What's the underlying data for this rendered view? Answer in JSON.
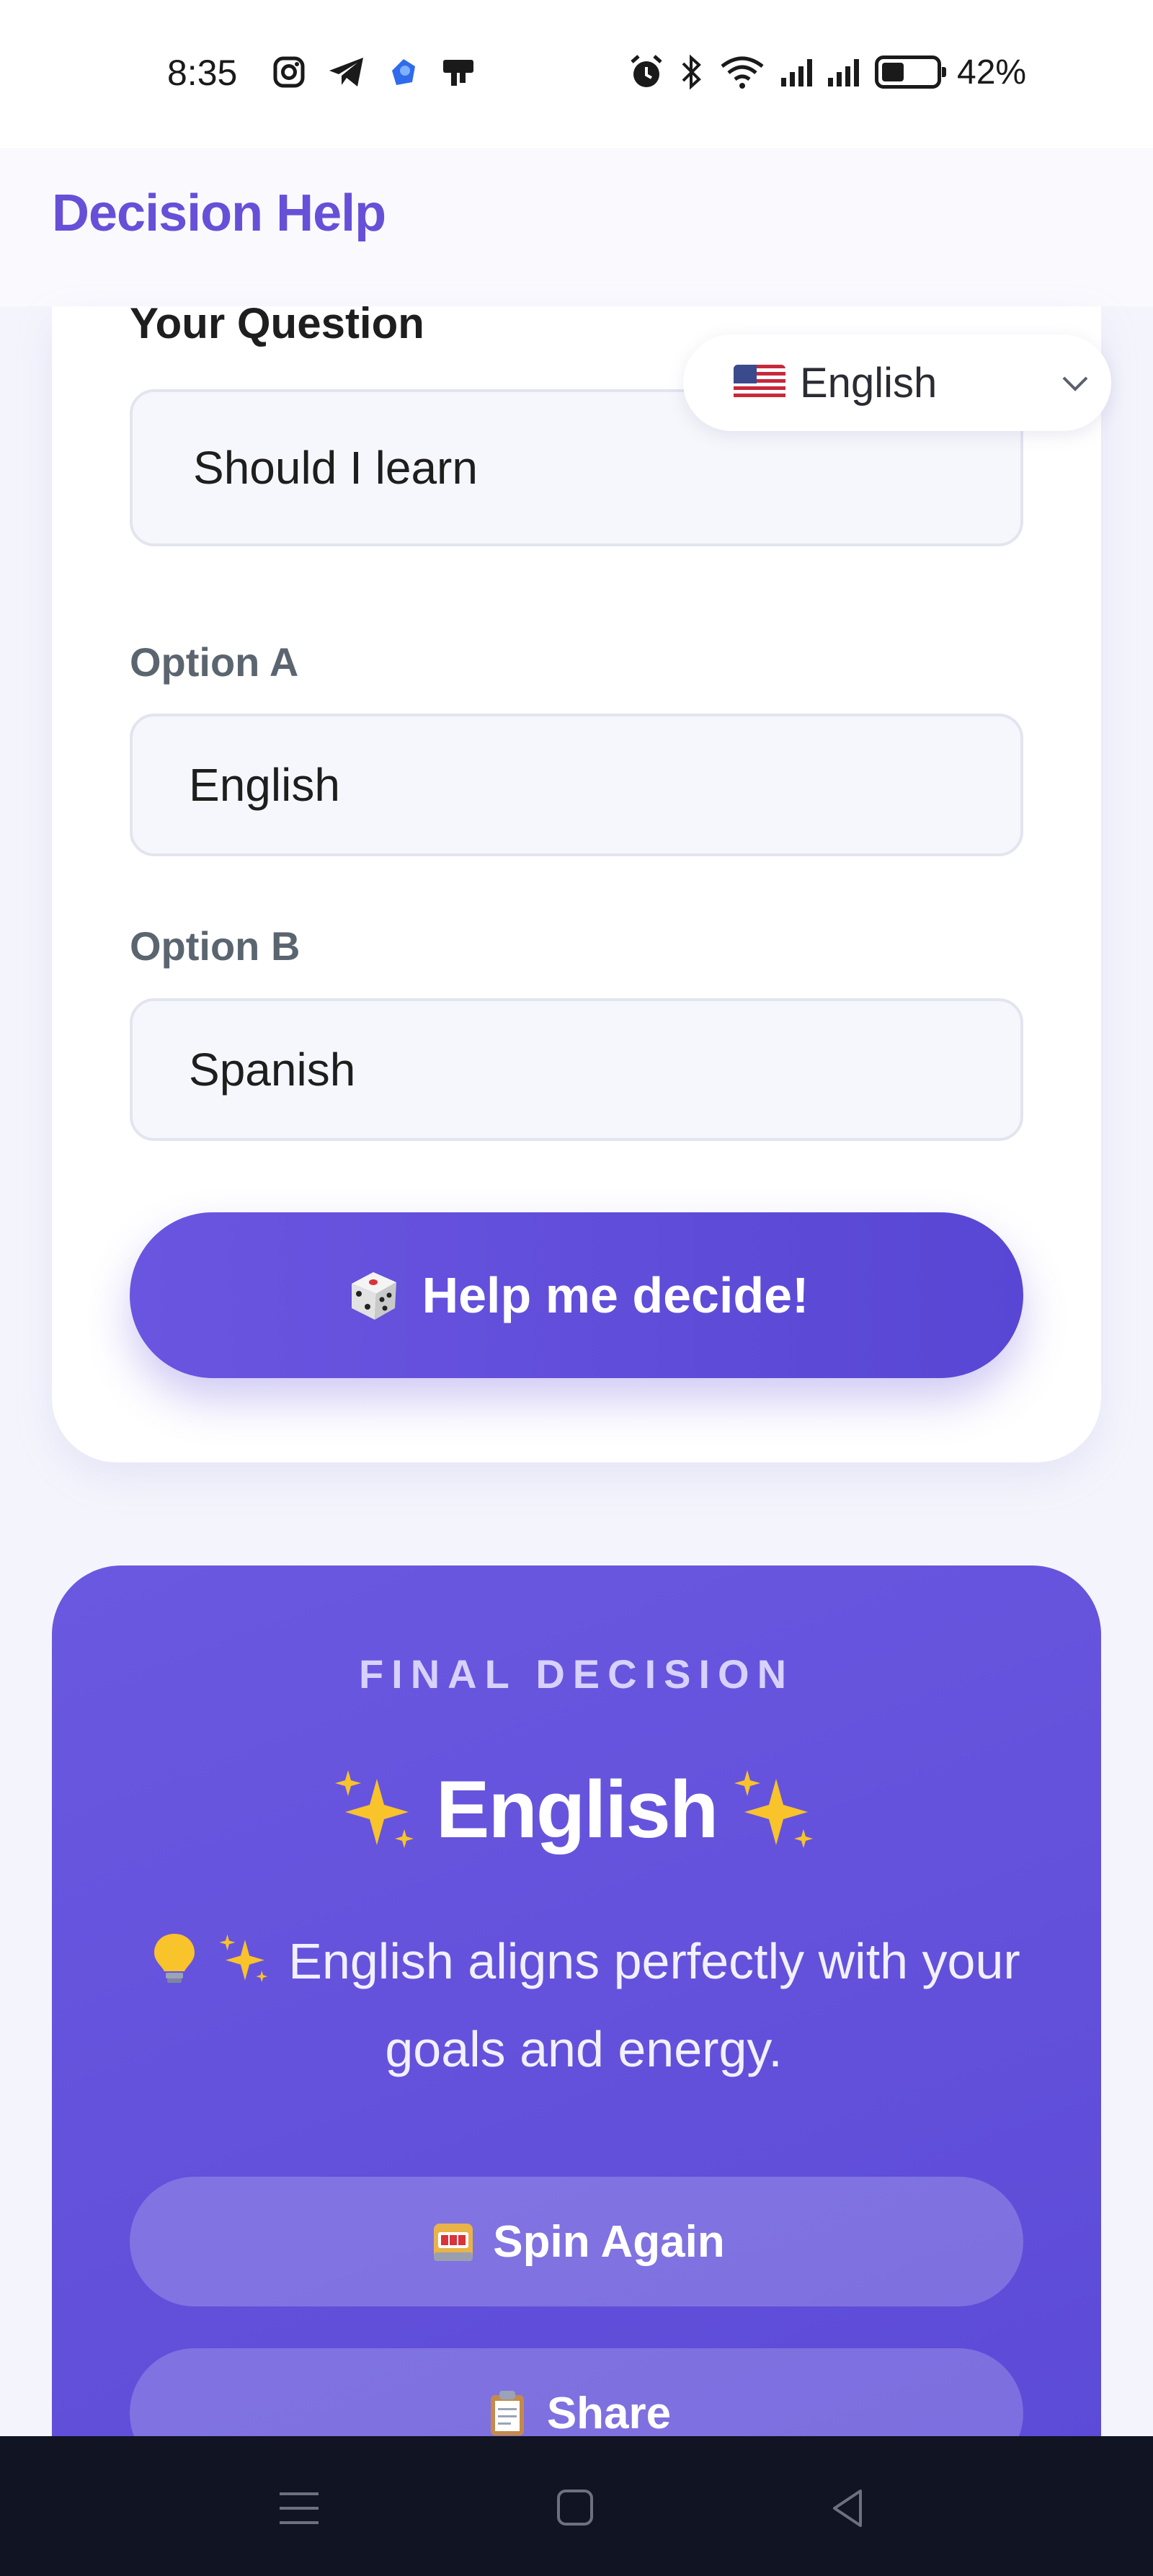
{
  "status_bar": {
    "time": "8:35",
    "battery_text": "42%",
    "battery_level": 0.42,
    "left_icons": [
      "instagram-icon",
      "telegram-icon",
      "app-icon",
      "notification-icon"
    ],
    "right_icons": [
      "alarm-icon",
      "bluetooth-icon",
      "wifi-icon",
      "signal-icon",
      "signal-icon",
      "battery-icon"
    ]
  },
  "header": {
    "title": "Decision Help"
  },
  "language_select": {
    "flag": "us-flag-icon",
    "value": "English"
  },
  "form": {
    "question_label": "Your Question",
    "question_value": "Should I learn",
    "option_a_label": "Option A",
    "option_a_value": "English",
    "option_b_label": "Option B",
    "option_b_value": "Spanish",
    "decide_button": "Help me decide!",
    "decide_icon": "dice-icon"
  },
  "result": {
    "label": "FINAL DECISION",
    "choice": "English",
    "reason": "English aligns perfectly with your goals and energy.",
    "spin_button": "Spin Again",
    "spin_icon": "slot-machine-icon",
    "share_button": "Share",
    "share_icon": "clipboard-icon"
  },
  "colors": {
    "brand": "#6750d8",
    "accent_gradient_start": "#6a55e0",
    "accent_gradient_end": "#5847d4",
    "background": "#f4f5fc"
  }
}
